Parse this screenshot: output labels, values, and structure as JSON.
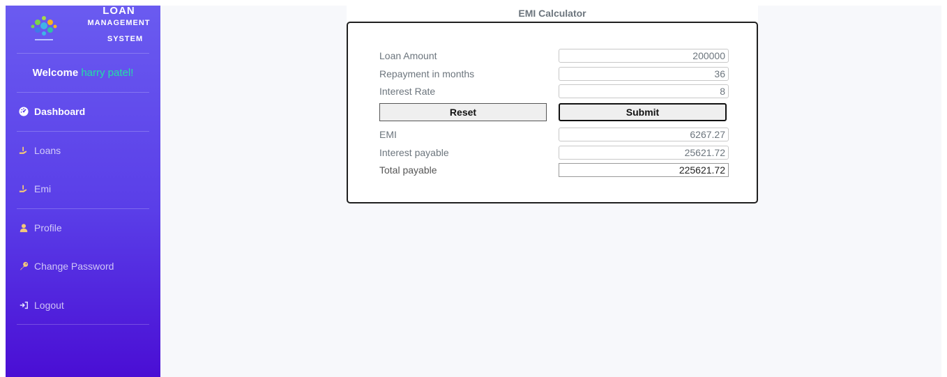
{
  "sidebar": {
    "brand": {
      "line1": "LOAN",
      "line2": "MANAGEMENT",
      "line3": "SYSTEM",
      "logo_icon": "puzzle-logo-icon"
    },
    "welcome": {
      "prefix": "Welcome ",
      "username": "harry patel!"
    },
    "items": [
      {
        "label": "Dashboard",
        "icon": "dashboard-icon",
        "active": true
      },
      {
        "label": "Loans",
        "icon": "hand-money-icon"
      },
      {
        "label": "Emi",
        "icon": "hand-money-icon"
      },
      {
        "label": "Profile",
        "icon": "user-icon"
      },
      {
        "label": "Change Password",
        "icon": "key-icon"
      },
      {
        "label": "Logout",
        "icon": "logout-icon"
      }
    ],
    "colors": {
      "gradient_top": "#6a5bf0",
      "gradient_bottom": "#4a0ed4",
      "username": "#22e0a5"
    }
  },
  "calculator": {
    "title": "EMI Calculator",
    "loan_amount": {
      "label": "Loan Amount",
      "value": "200000"
    },
    "repayment": {
      "label": "Repayment in months",
      "value": "36"
    },
    "interest_rate": {
      "label": "Interest Rate",
      "value": "8"
    },
    "reset_label": "Reset",
    "submit_label": "Submit",
    "emi": {
      "label": "EMI",
      "value": "6267.27"
    },
    "interest_payable": {
      "label": "Interest payable",
      "value": "25621.72"
    },
    "total_payable": {
      "label": "Total payable",
      "value": "225621.72"
    }
  }
}
